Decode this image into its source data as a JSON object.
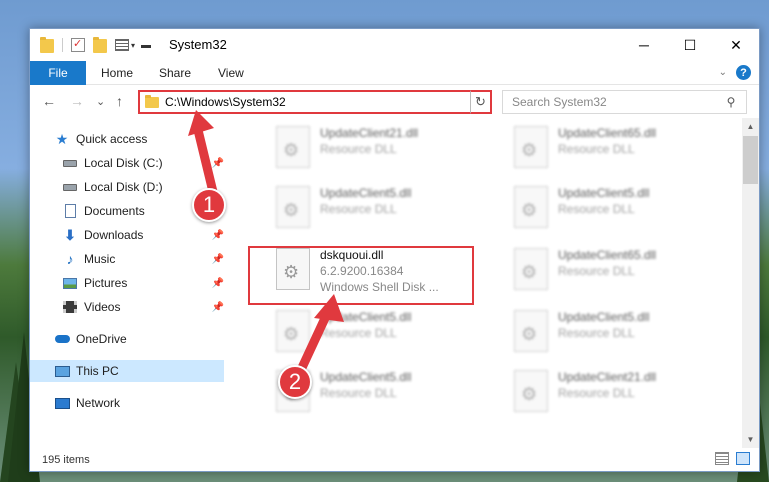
{
  "window": {
    "title": "System32",
    "controls": {
      "minimize": "─",
      "maximize": "☐",
      "close": "✕"
    }
  },
  "ribbon": {
    "tabs": [
      "File",
      "Home",
      "Share",
      "View"
    ],
    "help": "?"
  },
  "navigation": {
    "back": "←",
    "forward": "→",
    "recent": "⌄",
    "up": "↑",
    "address": "C:\\Windows\\System32",
    "refresh": "↻",
    "search_placeholder": "Search System32"
  },
  "sidebar": {
    "items": [
      {
        "label": "Quick access",
        "icon": "star-icon",
        "pinned": false
      },
      {
        "label": "Local Disk (C:)",
        "icon": "disk-icon",
        "pinned": true
      },
      {
        "label": "Local Disk (D:)",
        "icon": "disk-icon",
        "pinned": false
      },
      {
        "label": "Documents",
        "icon": "documents-icon",
        "pinned": true
      },
      {
        "label": "Downloads",
        "icon": "download-icon",
        "pinned": true
      },
      {
        "label": "Music",
        "icon": "music-icon",
        "pinned": true
      },
      {
        "label": "Pictures",
        "icon": "pictures-icon",
        "pinned": true
      },
      {
        "label": "Videos",
        "icon": "videos-icon",
        "pinned": true
      },
      {
        "label": "OneDrive",
        "icon": "onedrive-icon",
        "pinned": false
      },
      {
        "label": "This PC",
        "icon": "pc-icon",
        "pinned": false,
        "selected": true
      },
      {
        "label": "Network",
        "icon": "network-icon",
        "pinned": false
      }
    ]
  },
  "files": [
    {
      "name": "UpdateClient21.dll",
      "desc": "Resource DLL",
      "blurred": true
    },
    {
      "name": "UpdateClient65.dll",
      "desc": "Resource DLL",
      "blurred": true
    },
    {
      "name": "UpdateClient5.dll",
      "desc": "Resource DLL",
      "blurred": true
    },
    {
      "name": "UpdateClient5.dll",
      "desc": "Resource DLL",
      "blurred": true
    },
    {
      "name": "dskquoui.dll",
      "desc": "6.2.9200.16384",
      "extra": "Windows Shell Disk ...",
      "blurred": false,
      "highlighted": true
    },
    {
      "name": "UpdateClient65.dll",
      "desc": "Resource DLL",
      "blurred": true
    },
    {
      "name": "UpdateClient5.dll",
      "desc": "Resource DLL",
      "blurred": true
    },
    {
      "name": "UpdateClient5.dll",
      "desc": "Resource DLL",
      "blurred": true
    },
    {
      "name": "UpdateClient5.dll",
      "desc": "Resource DLL",
      "blurred": true
    },
    {
      "name": "UpdateClient21.dll",
      "desc": "Resource DLL",
      "blurred": true
    }
  ],
  "status": {
    "item_count": "195 items"
  },
  "annotations": {
    "step1": "1",
    "step2": "2",
    "color": "#e0393e"
  }
}
